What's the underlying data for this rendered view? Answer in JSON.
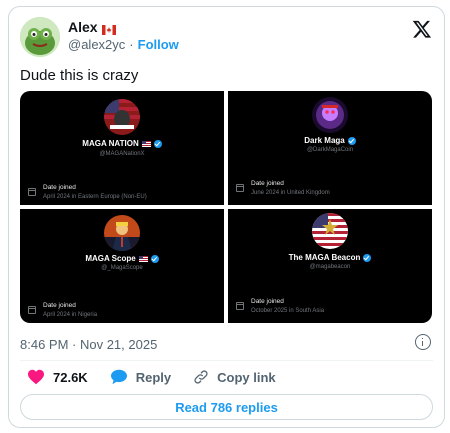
{
  "author": {
    "display_name": "Alex",
    "handle": "@alex2yc",
    "follow_label": "Follow",
    "separator": "·",
    "flag_icon": "canada-flag-icon"
  },
  "tweet": {
    "text": "Dude this is crazy",
    "timestamp": "8:46 PM · Nov 21, 2025"
  },
  "media": {
    "panels": [
      {
        "name": "MAGA NATION",
        "handle": "@MAGANationX",
        "date_joined_label": "Date joined",
        "date_joined_value": "April 2024 in Eastern Europe (Non-EU)",
        "has_flag": true
      },
      {
        "name": "Dark Maga",
        "handle": "@DarkMagaCoin",
        "date_joined_label": "Date joined",
        "date_joined_value": "June 2024 in United Kingdom",
        "has_flag": false
      },
      {
        "name": "MAGA Scope",
        "handle": "@_MagaScope",
        "date_joined_label": "Date joined",
        "date_joined_value": "April 2024 in Nigeria",
        "has_flag": true
      },
      {
        "name": "The MAGA Beacon",
        "handle": "@magabeacon",
        "date_joined_label": "Date joined",
        "date_joined_value": "October 2025 in South Asia",
        "has_flag": false
      }
    ]
  },
  "actions": {
    "likes": "72.6K",
    "reply_label": "Reply",
    "copy_link_label": "Copy link"
  },
  "read_replies_label": "Read 786 replies",
  "colors": {
    "accent": "#1d9bf0",
    "like": "#f91880",
    "muted": "#536471"
  }
}
